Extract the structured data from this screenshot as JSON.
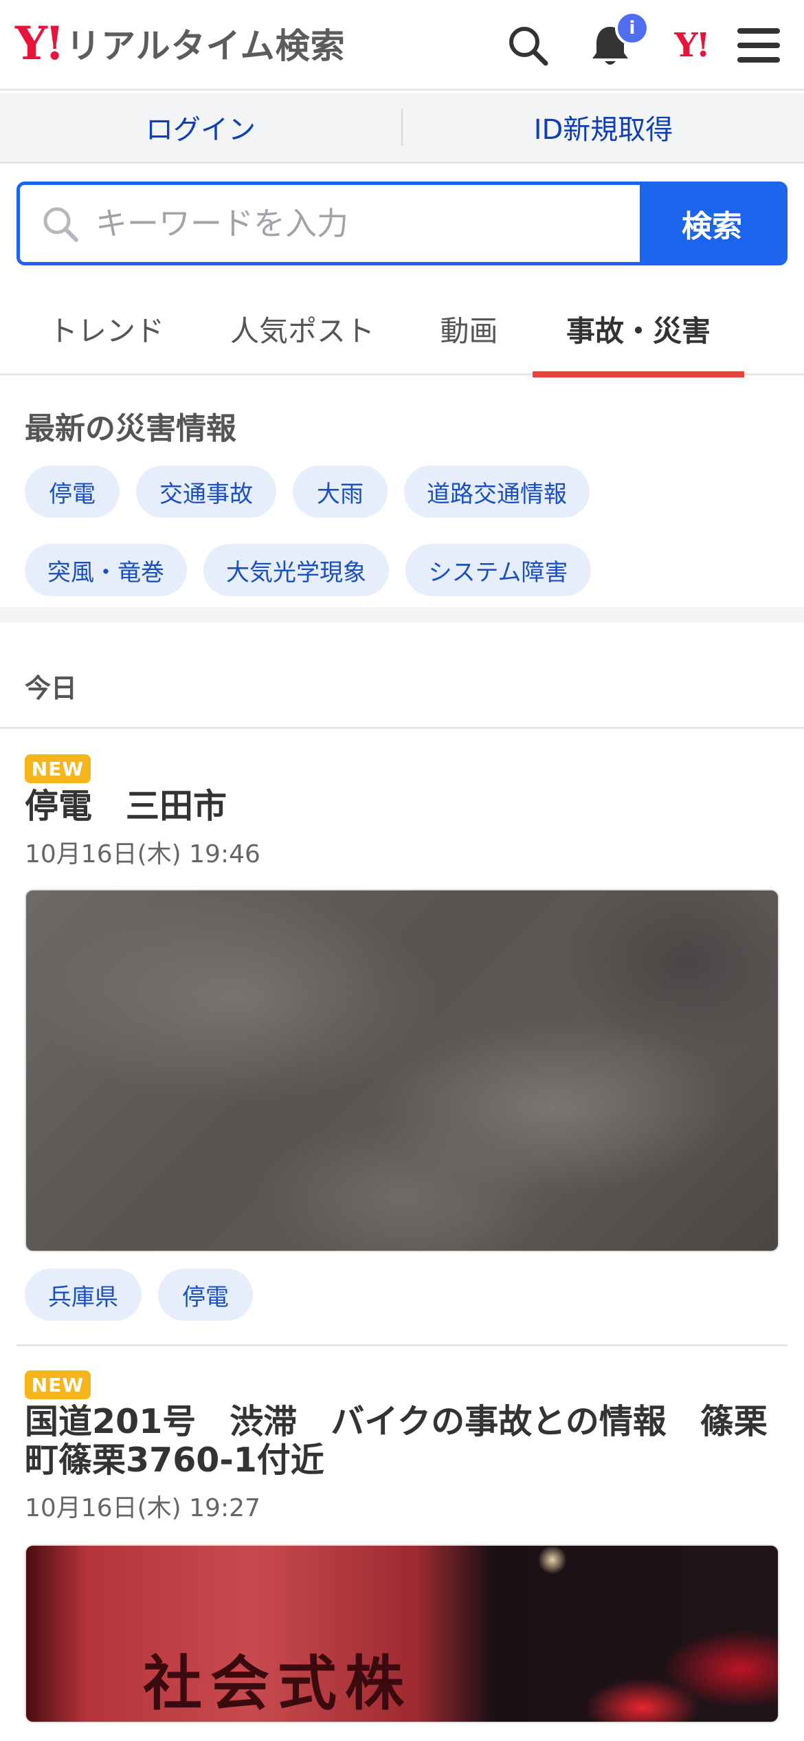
{
  "header": {
    "logo_mark": "Y!",
    "logo_text": "リアルタイム検索",
    "notification_count": "i",
    "yj_mark": "Y!"
  },
  "auth": {
    "login": "ログイン",
    "signup": "ID新規取得"
  },
  "search": {
    "placeholder": "キーワードを入力",
    "button": "検索"
  },
  "tabs": [
    {
      "label": "トレンド"
    },
    {
      "label": "人気ポスト"
    },
    {
      "label": "動画"
    },
    {
      "label": "事故・災害"
    }
  ],
  "active_tab": "事故・災害",
  "disaster": {
    "title": "最新の災害情報",
    "chips": [
      "停電",
      "交通事故",
      "大雨",
      "道路交通情報",
      "突風・竜巻",
      "大気光学現象",
      "システム障害"
    ]
  },
  "today_label": "今日",
  "articles": [
    {
      "badge": "NEW",
      "title": "停電　三田市",
      "time": "10月16日(木) 19:46",
      "tags": [
        "兵庫県",
        "停電"
      ]
    },
    {
      "badge": "NEW",
      "title": "国道201号　渋滞　バイクの事故との情報　篠栗町篠栗3760-1付近",
      "time": "10月16日(木) 19:27",
      "image_text": "社会式株"
    }
  ],
  "colors": {
    "brand_red": "#e8123a",
    "primary_blue": "#1a64ee",
    "chip_bg": "#e6eefb",
    "tab_underline": "#e0463c",
    "new_badge": "#f6b51b"
  }
}
